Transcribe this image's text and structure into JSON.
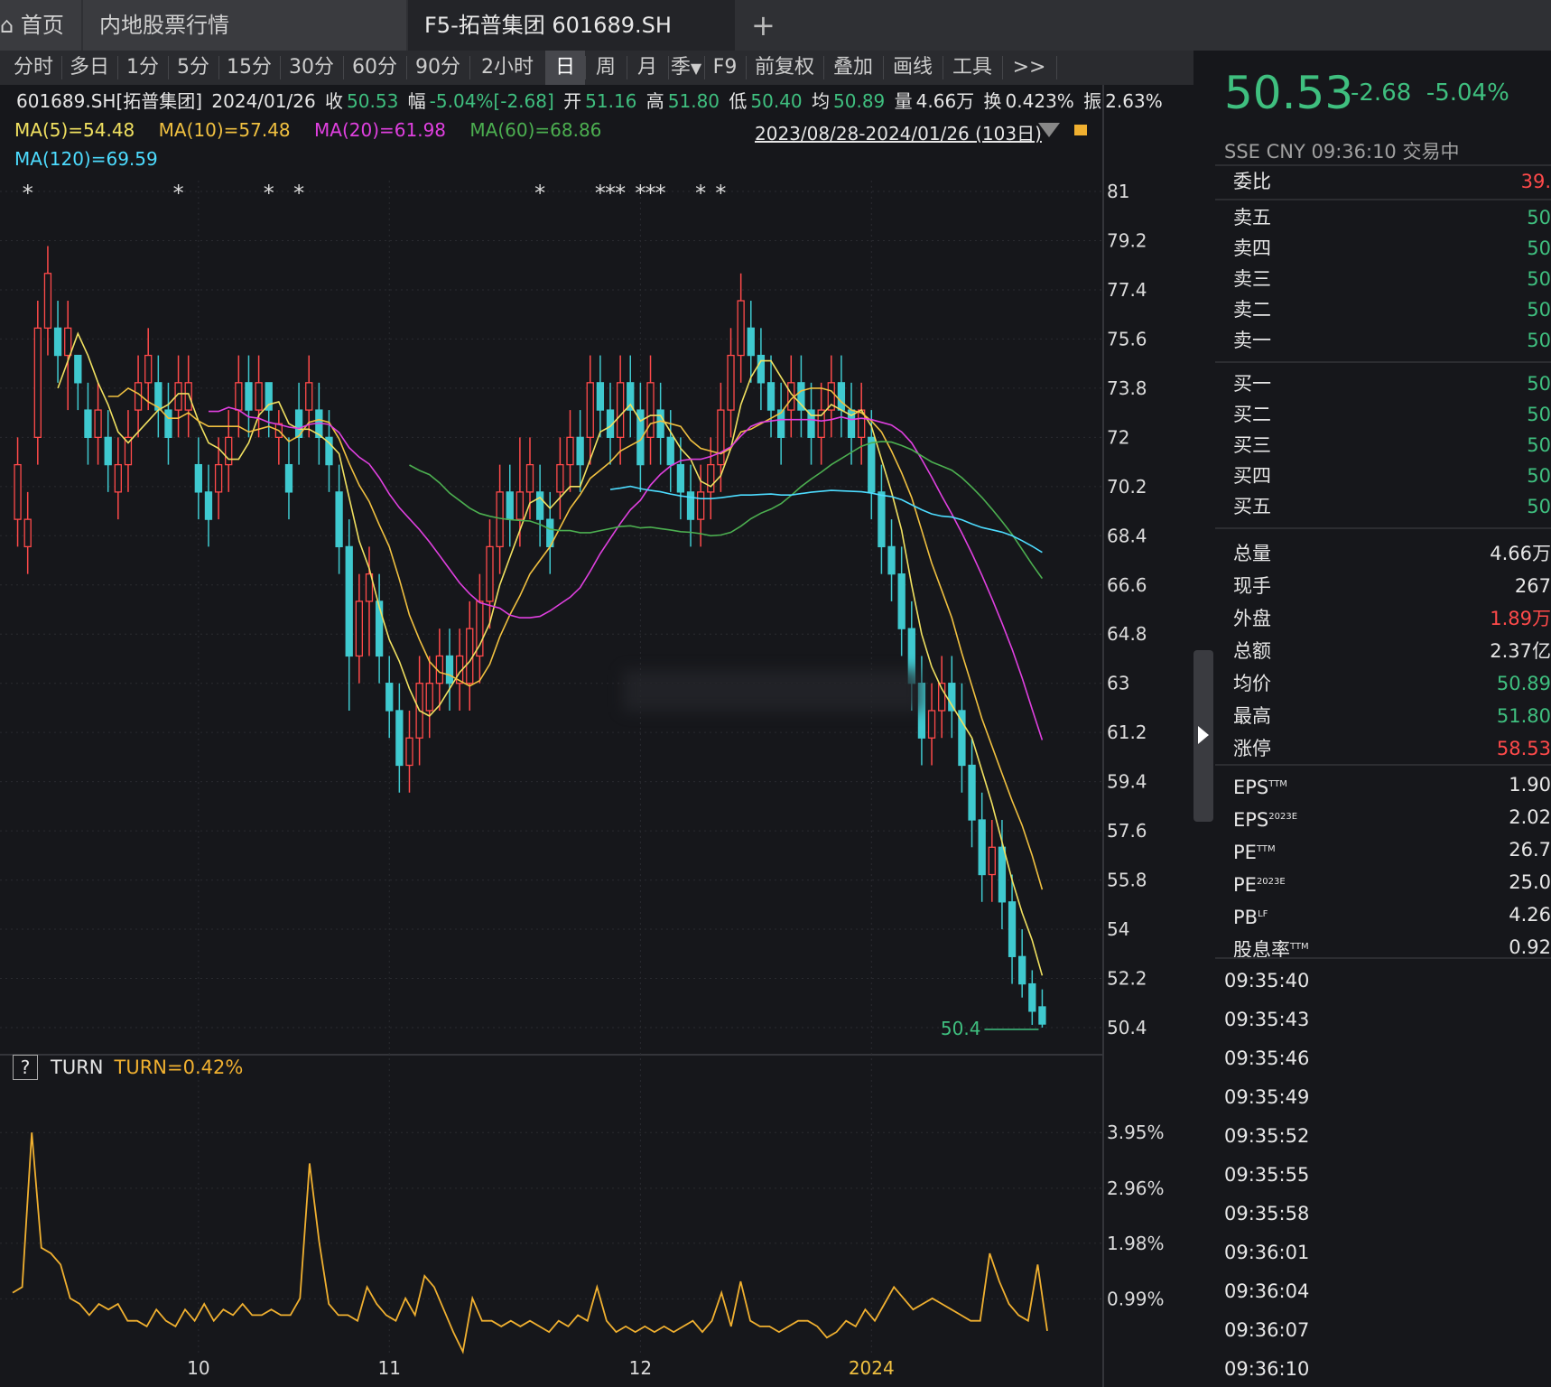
{
  "tabs": {
    "home": "首页",
    "market": "内地股票行情",
    "stock": "F5-拓普集团 601689.SH",
    "add": "+"
  },
  "toolbar": {
    "items": [
      "分时",
      "多日",
      "1分",
      "5分",
      "15分",
      "30分",
      "60分",
      "90分",
      "2小时",
      "日",
      "周",
      "月",
      "季",
      "F9",
      "前复权",
      "叠加",
      "画线",
      "工具",
      ">>"
    ],
    "active": "日"
  },
  "info": {
    "code": "601689.SH[拓普集团]",
    "date": "2024/01/26",
    "close_label": "收",
    "close": "50.53",
    "range_label": "幅",
    "range": "-5.04%[-2.68]",
    "open_label": "开",
    "open": "51.16",
    "high_label": "高",
    "high": "51.80",
    "low_label": "低",
    "low": "50.40",
    "avg_label": "均",
    "avg": "50.89",
    "vol_label": "量",
    "vol": "4.66万",
    "turn_label": "换",
    "turn": "0.423%",
    "amp_label": "振",
    "amp": "2.63%"
  },
  "ma": {
    "ma5": "MA(5)=54.48",
    "ma10": "MA(10)=57.48",
    "ma20": "MA(20)=61.98",
    "ma60": "MA(60)=68.86",
    "ma120": "MA(120)=69.59"
  },
  "date_range": "2023/08/28-2024/01/26 (103日)",
  "sub": {
    "name": "TURN",
    "value": "TURN=0.42%",
    "q": "?"
  },
  "colors": {
    "up": "#ff4a4a",
    "down": "#3fc9cf",
    "ma5": "#f0e060",
    "ma10": "#f0c040",
    "ma20": "#e040e0",
    "ma60": "#4caf50",
    "ma120": "#4ddcff",
    "turn": "#f0b030"
  },
  "chart_data": {
    "type": "candlestick",
    "x_labels": [
      "10",
      "11",
      "12",
      "2024"
    ],
    "y_ticks": [
      "81",
      "79.2",
      "77.4",
      "75.6",
      "73.8",
      "72",
      "70.2",
      "68.4",
      "66.6",
      "64.8",
      "63",
      "61.2",
      "59.4",
      "57.6",
      "55.8",
      "54",
      "52.2",
      "50.4"
    ],
    "ylim": [
      50.4,
      81
    ],
    "last_price_label": "50.4",
    "turn_ticks": [
      "3.95%",
      "2.96%",
      "1.98%",
      "0.99%"
    ],
    "candles": [
      [
        69,
        71,
        68,
        72
      ],
      [
        68,
        69,
        67,
        70
      ],
      [
        72,
        76,
        71,
        77
      ],
      [
        76,
        78,
        75,
        79
      ],
      [
        76,
        75,
        74,
        77
      ],
      [
        75,
        76,
        73,
        77
      ],
      [
        75,
        74,
        73,
        75
      ],
      [
        73,
        72,
        71,
        74
      ],
      [
        72,
        73,
        71,
        74
      ],
      [
        72,
        71,
        70,
        73
      ],
      [
        70,
        71,
        69,
        72
      ],
      [
        71,
        72,
        70,
        73
      ],
      [
        73,
        74,
        72,
        75
      ],
      [
        74,
        75,
        73,
        76
      ],
      [
        74,
        73,
        72,
        75
      ],
      [
        73,
        72,
        71,
        74
      ],
      [
        73,
        74,
        72,
        75
      ],
      [
        73,
        74,
        72,
        75
      ],
      [
        71,
        70,
        69,
        72
      ],
      [
        70,
        69,
        68,
        71
      ],
      [
        70,
        71,
        69,
        72
      ],
      [
        71,
        72,
        70,
        73
      ],
      [
        73,
        74,
        72,
        75
      ],
      [
        74,
        73,
        72,
        75
      ],
      [
        73,
        74,
        72,
        75
      ],
      [
        74,
        73,
        72,
        74
      ],
      [
        72,
        72.5,
        71,
        73
      ],
      [
        71,
        70,
        69,
        72
      ],
      [
        73,
        72,
        71,
        74
      ],
      [
        73,
        74,
        72,
        75
      ],
      [
        73,
        72,
        71,
        74
      ],
      [
        72,
        71,
        70,
        73
      ],
      [
        70,
        68,
        67,
        71
      ],
      [
        68,
        64,
        62,
        69
      ],
      [
        64,
        66,
        63,
        67
      ],
      [
        66,
        67,
        64,
        68
      ],
      [
        66,
        64,
        63,
        67
      ],
      [
        63,
        62,
        61,
        64
      ],
      [
        62,
        60,
        59,
        63
      ],
      [
        60,
        61,
        59,
        62
      ],
      [
        61,
        63,
        60,
        64
      ],
      [
        62,
        63,
        61,
        64
      ],
      [
        63,
        64,
        62,
        65
      ],
      [
        64,
        63,
        62,
        65
      ],
      [
        63,
        64,
        62,
        65
      ],
      [
        63,
        65,
        62,
        66
      ],
      [
        64,
        66,
        63,
        67
      ],
      [
        66,
        68,
        65,
        69
      ],
      [
        68,
        70,
        67,
        71
      ],
      [
        70,
        69,
        68,
        71
      ],
      [
        69,
        70,
        68,
        72
      ],
      [
        70,
        71,
        69,
        72
      ],
      [
        70,
        69,
        68,
        71
      ],
      [
        69,
        68,
        67,
        70
      ],
      [
        70,
        71,
        69,
        72
      ],
      [
        71,
        72,
        70,
        73
      ],
      [
        72,
        71,
        70,
        73
      ],
      [
        72,
        74,
        71,
        75
      ],
      [
        74,
        73,
        72,
        75
      ],
      [
        73,
        72,
        71,
        74
      ],
      [
        72,
        74,
        71,
        75
      ],
      [
        74,
        73,
        72,
        75
      ],
      [
        73,
        71,
        70,
        74
      ],
      [
        72,
        74,
        71,
        75
      ],
      [
        73,
        72,
        71,
        74
      ],
      [
        72,
        71,
        70,
        73
      ],
      [
        71,
        70,
        69,
        72
      ],
      [
        70,
        69,
        68,
        71
      ],
      [
        69,
        70,
        68,
        71
      ],
      [
        70,
        71,
        69,
        72
      ],
      [
        71,
        73,
        70,
        74
      ],
      [
        73,
        75,
        72,
        76
      ],
      [
        75,
        77,
        74,
        78
      ],
      [
        76,
        75,
        74,
        77
      ],
      [
        75,
        74,
        73,
        76
      ],
      [
        74,
        73,
        72,
        75
      ],
      [
        73,
        72,
        71,
        74
      ],
      [
        73,
        74,
        72,
        75
      ],
      [
        74,
        73,
        72,
        75
      ],
      [
        73,
        72,
        71,
        74
      ],
      [
        72,
        73,
        71,
        74
      ],
      [
        73,
        74,
        72,
        75
      ],
      [
        74,
        73,
        72,
        75
      ],
      [
        73,
        72,
        71,
        74
      ],
      [
        72,
        73,
        71,
        74
      ],
      [
        72,
        70,
        69,
        73
      ],
      [
        70,
        68,
        67,
        71
      ],
      [
        68,
        67,
        66,
        69
      ],
      [
        67,
        65,
        64,
        68
      ],
      [
        65,
        63,
        62,
        66
      ],
      [
        63,
        61,
        60,
        64
      ],
      [
        61,
        62,
        60,
        63
      ],
      [
        62,
        63,
        61,
        64
      ],
      [
        63,
        62,
        61,
        64
      ],
      [
        62,
        60,
        59,
        63
      ],
      [
        60,
        58,
        57,
        61
      ],
      [
        58,
        56,
        55,
        59
      ],
      [
        56,
        57,
        55,
        58
      ],
      [
        57,
        55,
        54,
        58
      ],
      [
        55,
        53,
        52,
        56
      ],
      [
        53,
        52,
        51.5,
        54
      ],
      [
        52,
        51,
        50.5,
        52.5
      ],
      [
        51.16,
        50.53,
        50.4,
        51.8
      ]
    ],
    "turn_values": [
      1.1,
      1.2,
      3.95,
      1.9,
      1.8,
      1.6,
      1.0,
      0.9,
      0.7,
      0.9,
      0.8,
      0.9,
      0.6,
      0.6,
      0.5,
      0.8,
      0.6,
      0.5,
      0.8,
      0.6,
      0.9,
      0.6,
      0.8,
      0.7,
      0.9,
      0.7,
      0.7,
      0.8,
      0.7,
      0.7,
      1.0,
      3.4,
      2.0,
      0.9,
      0.7,
      0.7,
      0.6,
      1.2,
      0.9,
      0.7,
      0.6,
      1.0,
      0.7,
      1.4,
      1.2,
      0.8,
      0.4,
      -0.1,
      1.0,
      0.6,
      0.6,
      0.5,
      0.6,
      0.5,
      0.6,
      0.5,
      0.4,
      0.6,
      0.5,
      0.7,
      0.6,
      1.2,
      0.6,
      0.4,
      0.5,
      0.4,
      0.5,
      0.4,
      0.5,
      0.4,
      0.5,
      0.6,
      0.4,
      0.6,
      1.1,
      0.5,
      1.3,
      0.6,
      0.5,
      0.5,
      0.4,
      0.5,
      0.6,
      0.6,
      0.5,
      0.3,
      0.4,
      0.6,
      0.5,
      0.8,
      0.6,
      0.9,
      1.2,
      1.0,
      0.8,
      0.9,
      1.0,
      0.9,
      0.8,
      0.7,
      0.6,
      0.6,
      1.8,
      1.3,
      0.9,
      0.7,
      0.6,
      1.6,
      0.42
    ]
  },
  "right": {
    "price": "50.53",
    "change": "-2.68",
    "change_pct": "-5.04%",
    "market_line": "SSE  CNY  09:36:10  交易中",
    "weibi": {
      "label": "委比",
      "value": "39."
    },
    "asks": [
      {
        "label": "卖五",
        "value": "50"
      },
      {
        "label": "卖四",
        "value": "50"
      },
      {
        "label": "卖三",
        "value": "50"
      },
      {
        "label": "卖二",
        "value": "50"
      },
      {
        "label": "卖一",
        "value": "50"
      }
    ],
    "bids": [
      {
        "label": "买一",
        "value": "50"
      },
      {
        "label": "买二",
        "value": "50"
      },
      {
        "label": "买三",
        "value": "50"
      },
      {
        "label": "买四",
        "value": "50"
      },
      {
        "label": "买五",
        "value": "50"
      }
    ],
    "stats": [
      {
        "label": "总量",
        "value": "4.66万",
        "color": "#e6e6e6"
      },
      {
        "label": "现手",
        "value": "267",
        "color": "#e6e6e6"
      },
      {
        "label": "外盘",
        "value": "1.89万",
        "color": "#ff4a4a"
      },
      {
        "label": "总额",
        "value": "2.37亿",
        "color": "#e6e6e6"
      },
      {
        "label": "均价",
        "value": "50.89",
        "color": "#3fbf7f"
      },
      {
        "label": "最高",
        "value": "51.80",
        "color": "#3fbf7f"
      },
      {
        "label": "涨停",
        "value": "58.53",
        "color": "#ff4a4a"
      }
    ],
    "fund": [
      {
        "label": "EPS",
        "sup": "TTM",
        "value": "1.90"
      },
      {
        "label": "EPS",
        "sup": "2023E",
        "value": "2.02"
      },
      {
        "label": "PE",
        "sup": "TTM",
        "value": "26.7"
      },
      {
        "label": "PE",
        "sup": "2023E",
        "value": "25.0"
      },
      {
        "label": "PB",
        "sup": "LF",
        "value": "4.26"
      },
      {
        "label": "股息率",
        "sup": "TTM",
        "value": "0.92"
      }
    ],
    "ticks": [
      "09:35:40",
      "09:35:43",
      "09:35:46",
      "09:35:49",
      "09:35:52",
      "09:35:55",
      "09:35:58",
      "09:36:01",
      "09:36:04",
      "09:36:07",
      "09:36:10"
    ]
  }
}
